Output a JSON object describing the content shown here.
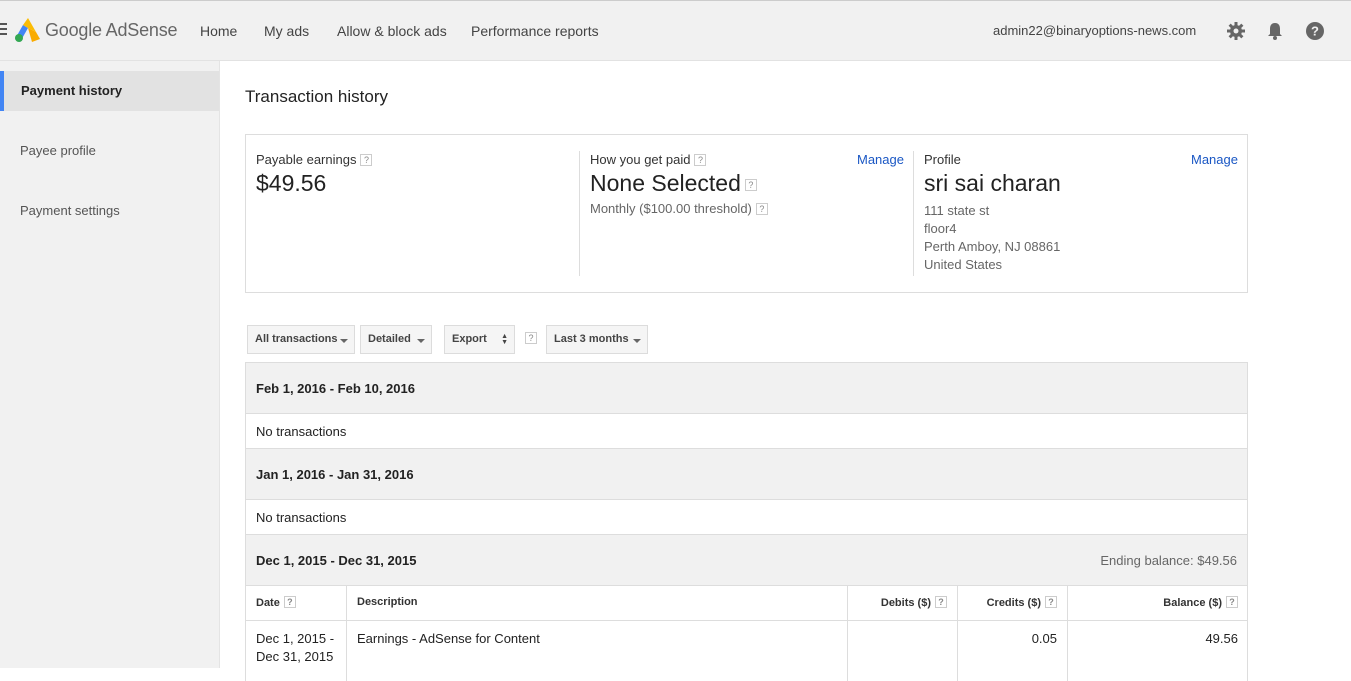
{
  "header": {
    "brand": "Google AdSense",
    "nav": [
      "Home",
      "My ads",
      "Allow & block ads",
      "Performance reports"
    ],
    "account": "admin22@binaryoptions-news.com",
    "icons": [
      "gear-icon",
      "bell-icon",
      "help-icon"
    ]
  },
  "sidebar": {
    "items": [
      {
        "label": "Payment history",
        "active": true
      },
      {
        "label": "Payee profile",
        "active": false
      },
      {
        "label": "Payment settings",
        "active": false
      }
    ]
  },
  "main": {
    "title": "Transaction history",
    "summary": {
      "earnings": {
        "label": "Payable earnings",
        "value": "$49.56"
      },
      "payment": {
        "label": "How you get paid",
        "manage": "Manage",
        "value": "None Selected",
        "schedule": "Monthly ($100.00 threshold)"
      },
      "profile": {
        "label": "Profile",
        "manage": "Manage",
        "name": "sri sai charan",
        "address": [
          "111 state st",
          "floor4",
          "Perth Amboy, NJ 08861",
          "United States"
        ]
      }
    },
    "controls": {
      "type": "All transactions",
      "detail": "Detailed",
      "export": "Export",
      "range": "Last 3 months"
    },
    "help_glyph": "?",
    "periods": [
      {
        "label": "Feb 1, 2016 - Feb 10, 2016",
        "empty": "No transactions"
      },
      {
        "label": "Jan 1, 2016 - Jan 31, 2016",
        "empty": "No transactions"
      },
      {
        "label": "Dec 1, 2015 - Dec 31, 2015",
        "ending": "Ending balance: $49.56"
      }
    ],
    "table": {
      "columns": [
        "Date",
        "Description",
        "Debits ($)",
        "Credits ($)",
        "Balance ($)"
      ],
      "rows": [
        {
          "date": "Dec 1, 2015 -",
          "date2": "Dec 31, 2015",
          "description": "Earnings - AdSense for Content",
          "debits": "",
          "credits": "0.05",
          "balance": "49.56"
        }
      ]
    }
  },
  "colors": {
    "accent": "#4285f4",
    "link": "#1a57c4",
    "topbar": "#f1f1f1"
  }
}
